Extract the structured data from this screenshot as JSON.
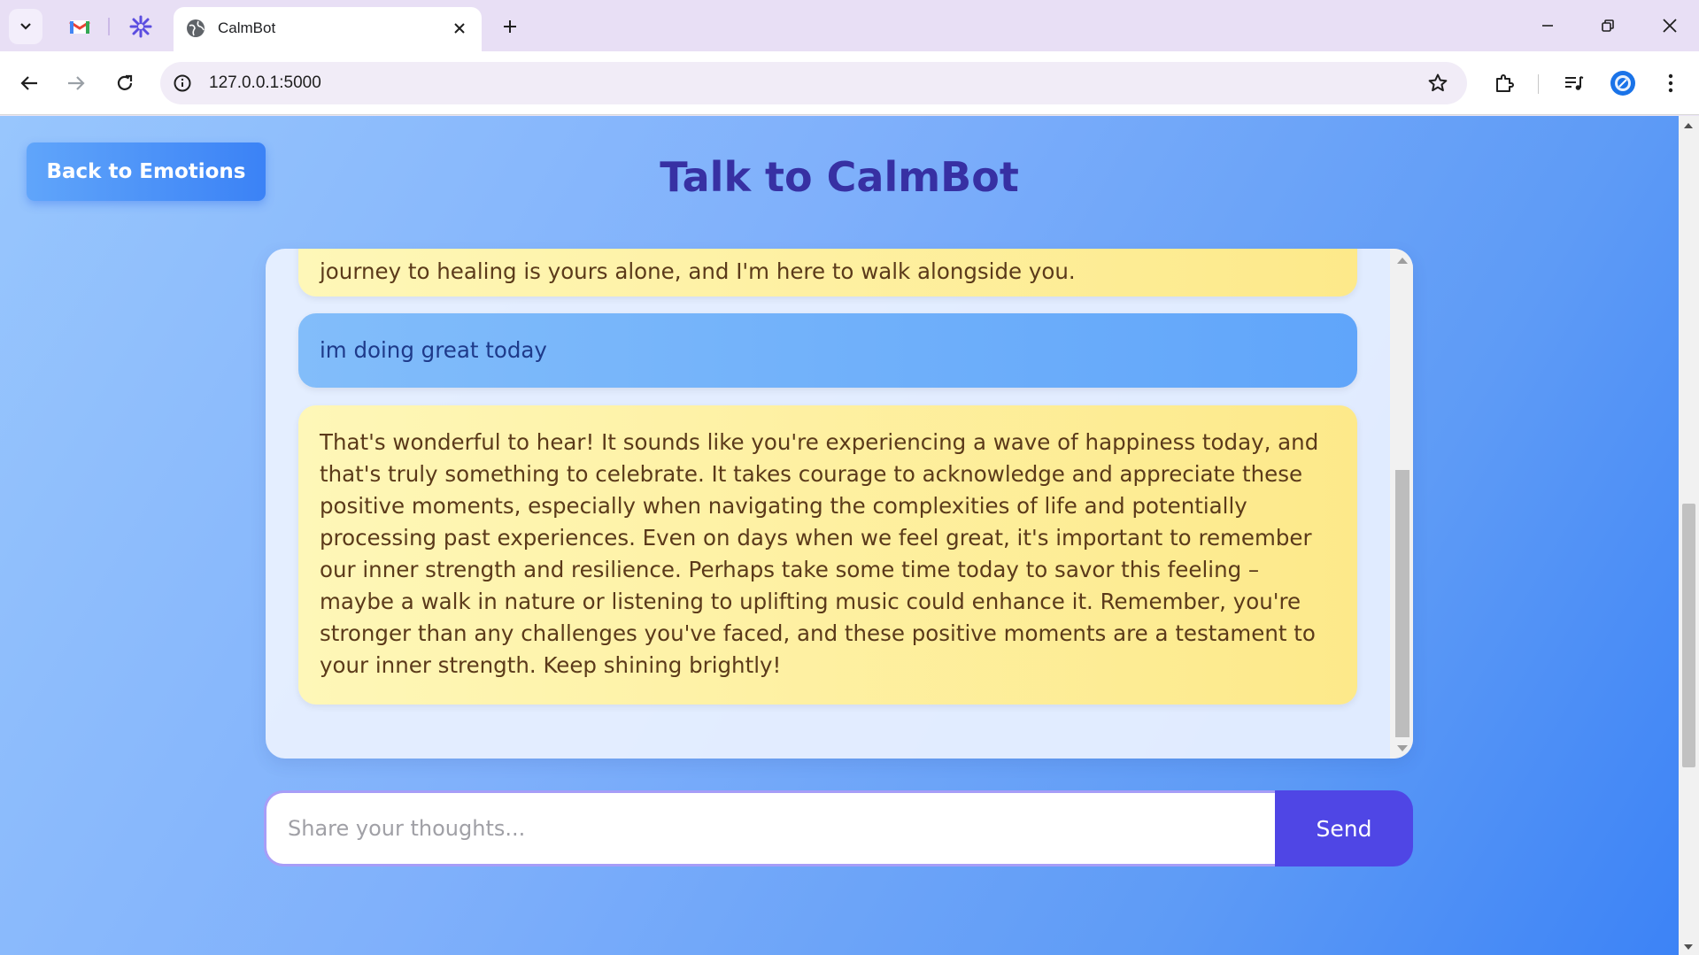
{
  "browser": {
    "tab_title": "CalmBot",
    "url": "127.0.0.1:5000",
    "pinned_tabs": [
      "gmail-icon",
      "asterisk-app-icon"
    ]
  },
  "page": {
    "back_button": "Back to Emotions",
    "title": "Talk to CalmBot"
  },
  "messages": [
    {
      "role": "bot",
      "text": "journey to healing is yours alone, and I'm here to walk alongside you."
    },
    {
      "role": "user",
      "text": "im doing great today"
    },
    {
      "role": "bot",
      "text": "That's wonderful to hear! It sounds like you're experiencing a wave of happiness today, and that's truly something to celebrate. It takes courage to acknowledge and appreciate these positive moments, especially when navigating the complexities of life and potentially processing past experiences. Even on days when we feel great, it's important to remember our inner strength and resilience. Perhaps take some time today to savor this feeling – maybe a walk in nature or listening to uplifting music could enhance it. Remember, you're stronger than any challenges you've faced, and these positive moments are a testament to your inner strength. Keep shining brightly!"
    }
  ],
  "composer": {
    "placeholder": "Share your thoughts...",
    "value": "",
    "send_label": "Send"
  },
  "colors": {
    "title": "#3730a3",
    "send_button": "#4f46e5",
    "bot_bubble": "#fde98a",
    "user_bubble": "#60a5fa"
  }
}
